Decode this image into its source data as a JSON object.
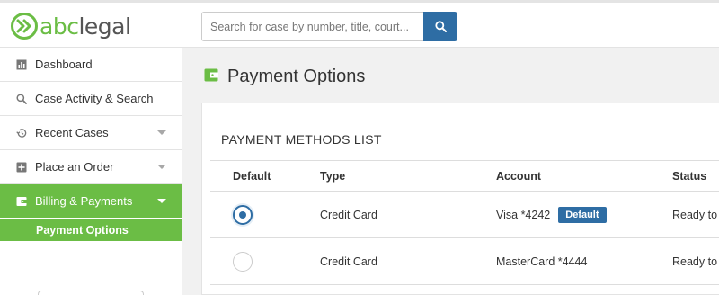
{
  "brand": {
    "logo_abc": "abc",
    "logo_legal": "legal",
    "accent": "#6bbd45"
  },
  "search": {
    "placeholder": "Search for case by number, title, court...",
    "value": ""
  },
  "sidebar": {
    "items": [
      {
        "label": "Dashboard",
        "icon": "bar-chart-icon"
      },
      {
        "label": "Case Activity & Search",
        "icon": "search-icon"
      },
      {
        "label": "Recent Cases",
        "icon": "history-icon"
      },
      {
        "label": "Place an Order",
        "icon": "plus-square-icon"
      },
      {
        "label": "Billing & Payments",
        "icon": "wallet-icon"
      }
    ],
    "sub_items": [
      {
        "label": "Payment Options"
      }
    ]
  },
  "page": {
    "title": "Payment Options",
    "icon": "wallet-icon"
  },
  "panel": {
    "title": "PAYMENT METHODS LIST",
    "columns": {
      "default": "Default",
      "type": "Type",
      "account": "Account",
      "status": "Status"
    },
    "rows": [
      {
        "is_default": true,
        "type": "Credit Card",
        "account": "Visa *4242",
        "badge": "Default",
        "status": "Ready to u"
      },
      {
        "is_default": false,
        "type": "Credit Card",
        "account": "MasterCard *4444",
        "badge": "",
        "status": "Ready to u"
      }
    ]
  },
  "colors": {
    "primary": "#2e6da4",
    "green": "#6bbd45"
  }
}
